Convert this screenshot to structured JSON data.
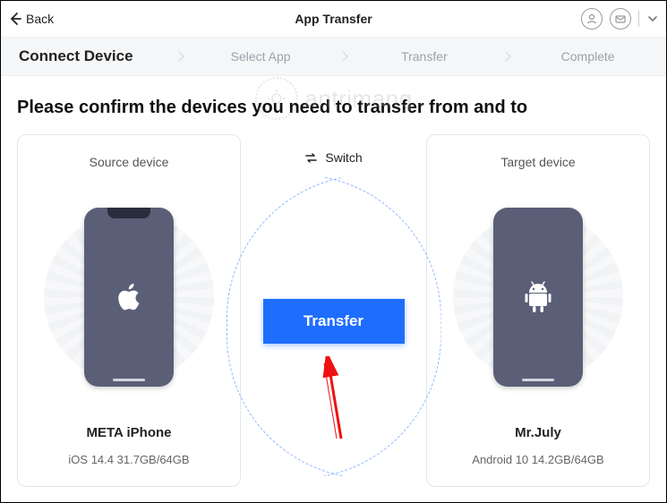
{
  "header": {
    "back_label": "Back",
    "app_title": "App Transfer"
  },
  "steps": {
    "s1": "Connect Device",
    "s2": "Select App",
    "s3": "Transfer",
    "s4": "Complete"
  },
  "heading": "Please confirm the devices you need to transfer from and to",
  "center": {
    "switch_label": "Switch",
    "transfer_label": "Transfer"
  },
  "source": {
    "title": "Source device",
    "name": "META iPhone",
    "sub": "iOS 14.4 31.7GB/64GB"
  },
  "target": {
    "title": "Target device",
    "name": "Mr.July",
    "sub": "Android 10 14.2GB/64GB"
  },
  "watermark": "antrimang",
  "colors": {
    "primary": "#1e6dff",
    "phone": "#5a5f77"
  }
}
